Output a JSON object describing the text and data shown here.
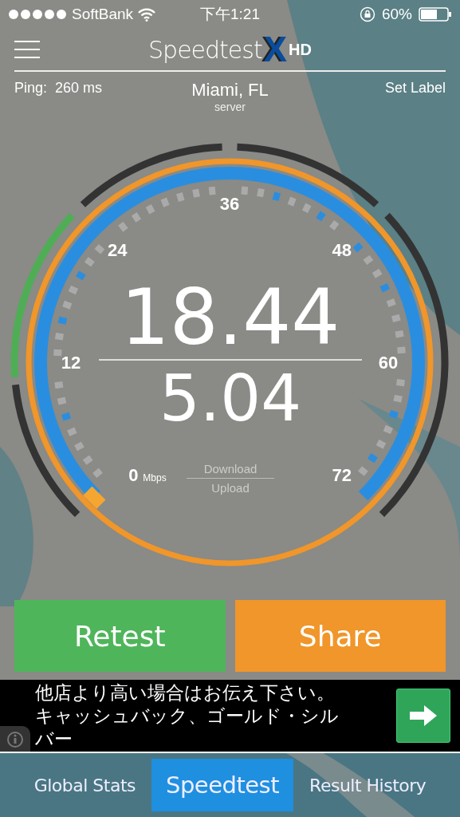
{
  "status_bar": {
    "carrier": "SoftBank",
    "time": "下午1:21",
    "battery": "60%"
  },
  "header": {
    "logo_name": "Speedtest",
    "logo_mark": "X",
    "logo_suffix": "HD"
  },
  "info": {
    "ping_label": "Ping:",
    "ping_value": "260",
    "ping_unit": "ms",
    "server": "Miami, FL",
    "server_caption": "server",
    "set_label": "Set Label"
  },
  "gauge": {
    "scale": [
      "0",
      "12",
      "24",
      "36",
      "48",
      "60",
      "72"
    ],
    "unit": "Mbps",
    "download": "18.44",
    "upload": "5.04",
    "download_label": "Download",
    "upload_label": "Upload"
  },
  "buttons": [
    {
      "label": "Retest",
      "kind": "retest"
    },
    {
      "label": "Share",
      "kind": "share"
    }
  ],
  "ad": {
    "lines": [
      "他店より高い場合はお伝え下さい。",
      "キャッシュバック、ゴールド・シル",
      "バー"
    ]
  },
  "tabs": [
    {
      "label": "Global Stats",
      "selected": false
    },
    {
      "label": "Speedtest",
      "selected": true
    },
    {
      "label": "Result History",
      "selected": false
    }
  ]
}
